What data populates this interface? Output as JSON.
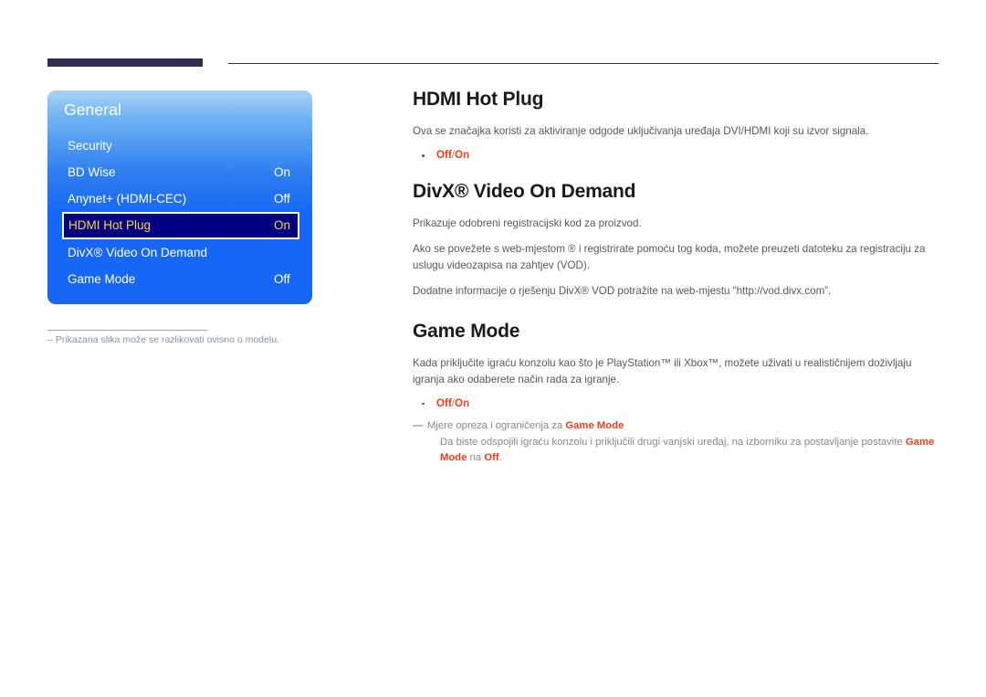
{
  "header": {
    "bar_color": "#2e2d4d",
    "line_color": "#2e2d4d"
  },
  "osd": {
    "title": "General",
    "items": [
      {
        "label": "Security",
        "value": "",
        "selected": false
      },
      {
        "label": "BD Wise",
        "value": "On",
        "selected": false
      },
      {
        "label": "Anynet+ (HDMI-CEC)",
        "value": "Off",
        "selected": false
      },
      {
        "label": "HDMI Hot Plug",
        "value": "On",
        "selected": true
      },
      {
        "label": "DivX® Video On Demand",
        "value": "",
        "selected": false
      },
      {
        "label": "Game Mode",
        "value": "Off",
        "selected": false
      }
    ],
    "highlight_text_color": "#ffd24a",
    "highlight_bg_color": "#000080"
  },
  "note": {
    "dash": "–",
    "text": "Prikazana slika može se razlikovati ovisno o modelu."
  },
  "sections": {
    "hdmi_hot_plug": {
      "title": "HDMI Hot Plug",
      "paragraph": "Ova se značajka koristi za aktiviranje odgode uključivanja uređaja DVI/HDMI koji su izvor signala.",
      "option_off": "Off",
      "option_sep": "/",
      "option_on": "On"
    },
    "divx_vod": {
      "title": "DivX® Video On Demand",
      "paragraph1": "Prikazuje odobreni registracijski kod za proizvod.",
      "paragraph2": "Ako se povežete s web-mjestom ® i registrirate pomoću tog koda, možete preuzeti datoteku za registraciju za uslugu videozapisa na zahtjev (VOD).",
      "paragraph3": "Dodatne informacije o rješenju  DivX® VOD potražite na web-mjestu “http://vod.divx.com”."
    },
    "game_mode": {
      "title": "Game Mode",
      "paragraph": "Kada priključite igraću konzolu kao što je PlayStation™ ili Xbox™, možete uživati u realističnijem doživljaju igranja ako odaberete način rada za igranje.",
      "option_off": "Off",
      "option_sep": "/",
      "option_on": "On",
      "caution": {
        "dash": "—",
        "lead": "Mjere opreza i ograničenja za ",
        "lead_highlight": "Game Mode",
        "body_part1": "Da biste odspojili igraću konzolu i priključili drugi vanjski uređaj, na izborniku za postavljanje postavite ",
        "body_highlight1": "Game Mode",
        "body_part2": " na ",
        "body_highlight2": "Off",
        "body_part3": "."
      }
    }
  }
}
